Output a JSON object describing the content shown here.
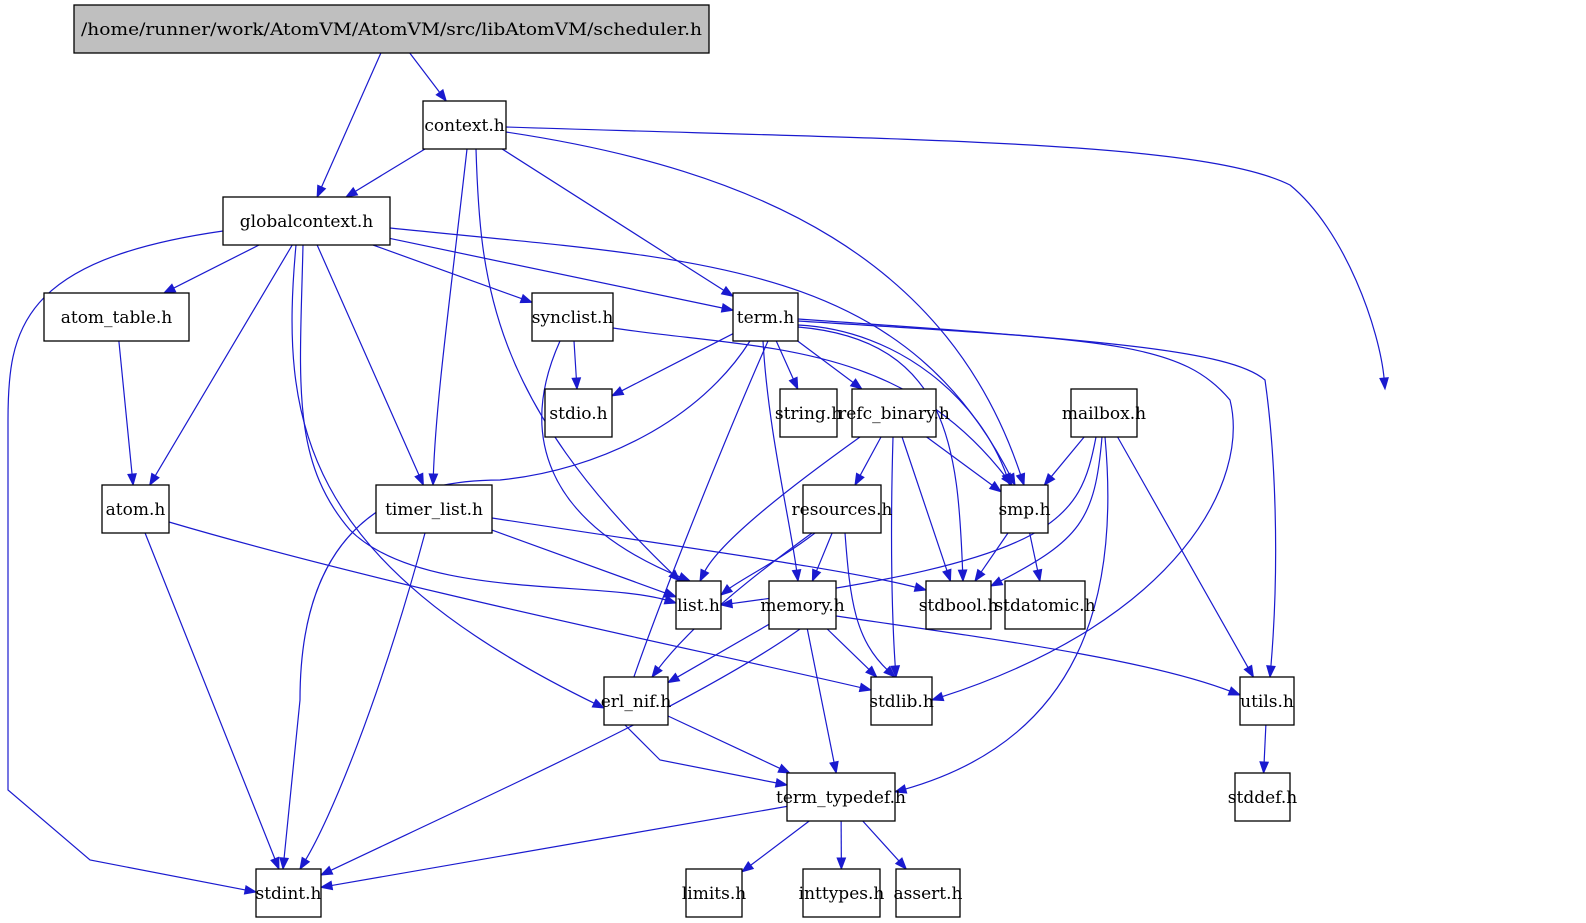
{
  "title": "/home/runner/work/AtomVM/AtomVM/src/libAtomVM/scheduler.h",
  "colors": {
    "edge": "#1a1acf",
    "root_fill": "#bfbfbf",
    "node_fill": "#ffffff",
    "node_border": "#000000"
  },
  "nodes": [
    {
      "id": "scheduler",
      "label": "/home/runner/work/AtomVM/AtomVM/src/libAtomVM/scheduler.h",
      "root": true
    },
    {
      "id": "context",
      "label": "context.h"
    },
    {
      "id": "globalcontext",
      "label": "globalcontext.h"
    },
    {
      "id": "atom_table",
      "label": "atom_table.h"
    },
    {
      "id": "synclist",
      "label": "synclist.h"
    },
    {
      "id": "term",
      "label": "term.h"
    },
    {
      "id": "stdio",
      "label": "stdio.h"
    },
    {
      "id": "string",
      "label": "string.h"
    },
    {
      "id": "refc_binary",
      "label": "refc_binary.h"
    },
    {
      "id": "mailbox",
      "label": "mailbox.h"
    },
    {
      "id": "atom",
      "label": "atom.h"
    },
    {
      "id": "timer_list",
      "label": "timer_list.h"
    },
    {
      "id": "resources",
      "label": "resources.h"
    },
    {
      "id": "smp",
      "label": "smp.h"
    },
    {
      "id": "list",
      "label": "list.h"
    },
    {
      "id": "memory",
      "label": "memory.h"
    },
    {
      "id": "stdbool",
      "label": "stdbool.h"
    },
    {
      "id": "stdatomic",
      "label": "stdatomic.h"
    },
    {
      "id": "erl_nif",
      "label": "erl_nif.h"
    },
    {
      "id": "stdlib",
      "label": "stdlib.h"
    },
    {
      "id": "utils",
      "label": "utils.h"
    },
    {
      "id": "term_typedef",
      "label": "term_typedef.h"
    },
    {
      "id": "stddef",
      "label": "stddef.h"
    },
    {
      "id": "stdint",
      "label": "stdint.h"
    },
    {
      "id": "limits",
      "label": "limits.h"
    },
    {
      "id": "inttypes",
      "label": "inttypes.h"
    },
    {
      "id": "assert",
      "label": "assert.h"
    }
  ],
  "edges": [
    [
      "scheduler",
      "context"
    ],
    [
      "scheduler",
      "globalcontext"
    ],
    [
      "context",
      "globalcontext"
    ],
    [
      "context",
      "timer_list"
    ],
    [
      "context",
      "list"
    ],
    [
      "context",
      "term"
    ],
    [
      "context",
      "smp"
    ],
    [
      "context",
      "mailbox"
    ],
    [
      "globalcontext",
      "stdint"
    ],
    [
      "globalcontext",
      "atom_table"
    ],
    [
      "globalcontext",
      "atom"
    ],
    [
      "globalcontext",
      "erl_nif"
    ],
    [
      "globalcontext",
      "list"
    ],
    [
      "globalcontext",
      "timer_list"
    ],
    [
      "globalcontext",
      "synclist"
    ],
    [
      "globalcontext",
      "term"
    ],
    [
      "globalcontext",
      "smp"
    ],
    [
      "atom_table",
      "atom"
    ],
    [
      "atom",
      "stdint"
    ],
    [
      "atom",
      "stdlib"
    ],
    [
      "synclist",
      "stdio"
    ],
    [
      "synclist",
      "list"
    ],
    [
      "synclist",
      "smp"
    ],
    [
      "term",
      "stdint"
    ],
    [
      "term",
      "stdio"
    ],
    [
      "term",
      "string"
    ],
    [
      "term",
      "refc_binary"
    ],
    [
      "term",
      "memory"
    ],
    [
      "term",
      "term_typedef"
    ],
    [
      "term",
      "stdbool"
    ],
    [
      "term",
      "smp"
    ],
    [
      "term",
      "stdlib"
    ],
    [
      "term",
      "utils"
    ],
    [
      "timer_list",
      "list"
    ],
    [
      "timer_list",
      "stdint"
    ],
    [
      "timer_list",
      "stdbool"
    ],
    [
      "refc_binary",
      "resources"
    ],
    [
      "refc_binary",
      "list"
    ],
    [
      "refc_binary",
      "stdlib"
    ],
    [
      "refc_binary",
      "stdbool"
    ],
    [
      "refc_binary",
      "smp"
    ],
    [
      "mailbox",
      "smp"
    ],
    [
      "mailbox",
      "list"
    ],
    [
      "mailbox",
      "stdbool"
    ],
    [
      "mailbox",
      "term_typedef"
    ],
    [
      "mailbox",
      "utils"
    ],
    [
      "resources",
      "list"
    ],
    [
      "resources",
      "memory"
    ],
    [
      "resources",
      "erl_nif"
    ],
    [
      "resources",
      "stdlib"
    ],
    [
      "smp",
      "stdbool"
    ],
    [
      "smp",
      "stdatomic"
    ],
    [
      "memory",
      "erl_nif"
    ],
    [
      "memory",
      "stdint"
    ],
    [
      "memory",
      "stdlib"
    ],
    [
      "memory",
      "term_typedef"
    ],
    [
      "memory",
      "utils"
    ],
    [
      "erl_nif",
      "term_typedef"
    ],
    [
      "utils",
      "stddef"
    ],
    [
      "term_typedef",
      "stdint"
    ],
    [
      "term_typedef",
      "limits"
    ],
    [
      "term_typedef",
      "inttypes"
    ],
    [
      "term_typedef",
      "assert"
    ]
  ]
}
